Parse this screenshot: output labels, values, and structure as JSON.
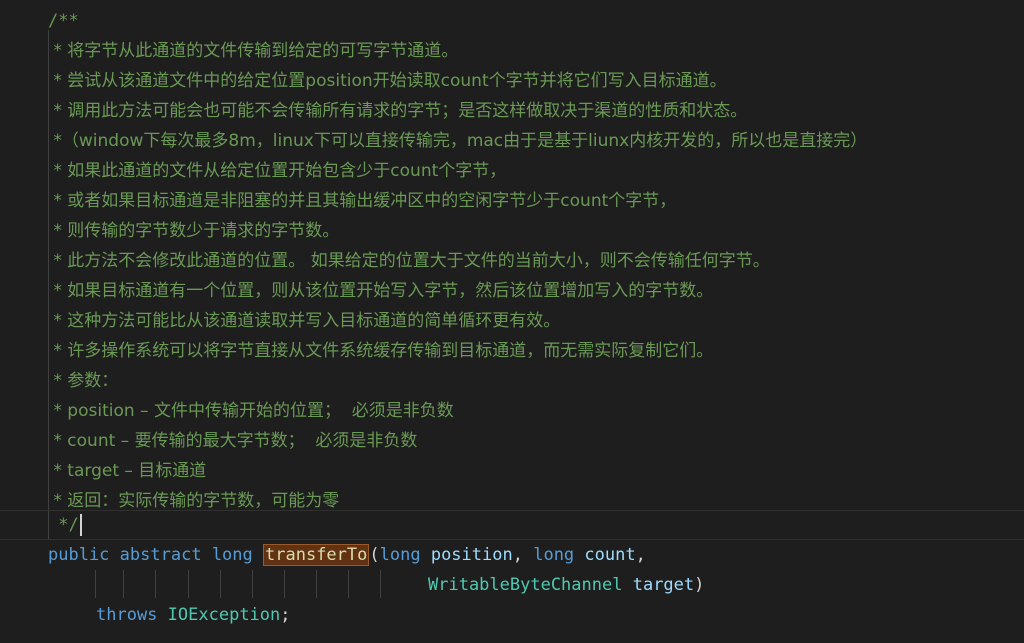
{
  "editor": {
    "comment_open": "/**",
    "comment_lines": [
      " * 将字节从此通道的文件传输到给定的可写字节通道。",
      " * 尝试从该通道文件中的给定位置position开始读取count个字节并将它们写入目标通道。",
      " * 调用此方法可能会也可能不会传输所有请求的字节；是否这样做取决于渠道的性质和状态。",
      " *（window下每次最多8m，linux下可以直接传输完，mac由于是基于liunx内核开发的，所以也是直接完）",
      " * 如果此通道的文件从给定位置开始包含少于count个字节，",
      " * 或者如果目标通道是非阻塞的并且其输出缓冲区中的空闲字节少于count个字节，",
      " * 则传输的字节数少于请求的字节数。",
      " * 此方法不会修改此通道的位置。 如果给定的位置大于文件的当前大小，则不会传输任何字节。",
      " * 如果目标通道有一个位置，则从该位置开始写入字节，然后该位置增加写入的字节数。",
      " * 这种方法可能比从该通道读取并写入目标通道的简单循环更有效。",
      " * 许多操作系统可以将字节直接从文件系统缓存传输到目标通道，而无需实际复制它们。",
      " * 参数：",
      " * position – 文件中传输开始的位置；  必须是非负数",
      " * count – 要传输的最大字节数；  必须是非负数",
      " * target – 目标通道",
      " * 返回：实际传输的字节数，可能为零"
    ],
    "comment_close": " */",
    "signature": {
      "kw_public": "public",
      "kw_abstract": "abstract",
      "kw_long": "long",
      "method_name": "transferTo",
      "open_paren": "(",
      "param1_type": "long",
      "param1_name": "position",
      "comma1": ",",
      "param2_type": "long",
      "param2_name": "count",
      "comma2": ",",
      "param3_type": "WritableByteChannel",
      "param3_name": "target",
      "close_paren": ")",
      "kw_throws": "throws",
      "exception_type": "IOException",
      "semicolon": ";"
    }
  },
  "colors": {
    "background": "#1e1e1e",
    "comment": "#6a9955",
    "keyword": "#569cd6",
    "identifier": "#9cdcfe",
    "type": "#4ec9b0",
    "highlight": "#613214"
  }
}
